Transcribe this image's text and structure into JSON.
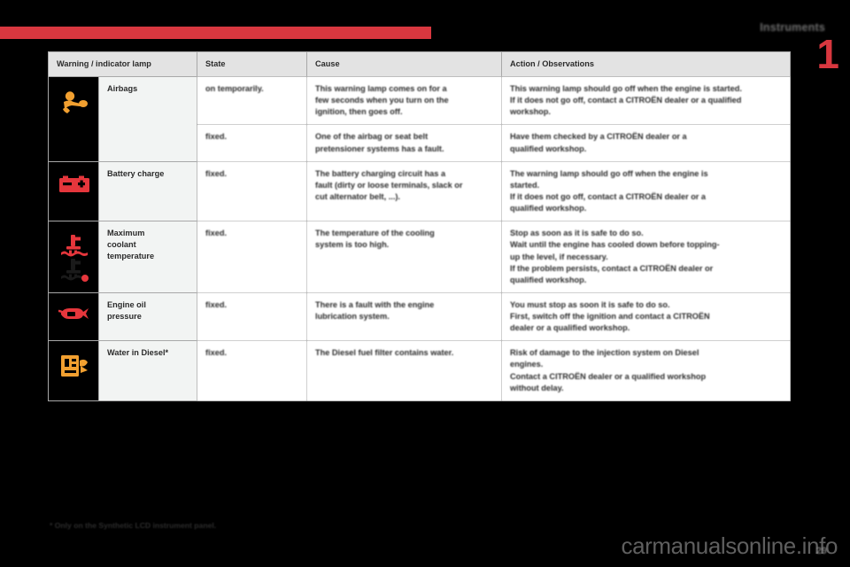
{
  "header": {
    "chapter_title": "Instruments",
    "chapter_number": "1",
    "rule_color": "#d8373f"
  },
  "table": {
    "columns": [
      {
        "label_main": "Warning",
        "separator": " / ",
        "label_sub": "indicator lamp",
        "full": "Warning / indicator lamp"
      },
      {
        "full": "State"
      },
      {
        "full": "Cause"
      },
      {
        "label_main": "Action",
        "separator": " / ",
        "label_sub": "Observations",
        "full": "Action / Observations"
      }
    ],
    "rows": [
      {
        "icon": "airbag-warning-icon",
        "icon_color": "#f2a030",
        "name": "Airbags",
        "name_rowspan": 2,
        "states": [
          {
            "state": "on temporarily.",
            "cause": [
              "This warning lamp comes on for a",
              "few seconds when you turn on the",
              "ignition, then goes off."
            ],
            "action": [
              "This warning lamp should go off when the engine is started.",
              "If it does not go off, contact a CITROËN dealer or a qualified",
              "workshop."
            ]
          },
          {
            "state": "fixed.",
            "cause": [
              "One of the airbag or seat belt",
              "pretensioner systems has a fault."
            ],
            "action": [
              "Have them checked by a CITROËN dealer or a",
              "qualified workshop."
            ]
          }
        ]
      },
      {
        "icon": "battery-charge-icon",
        "icon_color": "#e5363c",
        "name": "Battery charge",
        "name_rowspan": 1,
        "states": [
          {
            "state": "fixed.",
            "cause": [
              "The battery charging circuit has a",
              "fault (dirty or loose terminals, slack or",
              "cut alternator belt, ...)."
            ],
            "action": [
              "The warning lamp should go off when the engine is",
              "started.",
              "If it does not go off, contact a CITROËN dealer or a",
              "qualified workshop."
            ]
          }
        ]
      },
      {
        "icon": "coolant-temperature-icon",
        "icon_color": "#e5363c",
        "name": "Maximum coolant temperature",
        "name_lines": [
          "Maximum",
          "coolant",
          "temperature"
        ],
        "name_rowspan": 1,
        "states": [
          {
            "state": "fixed.",
            "cause": [
              "The temperature of the cooling",
              "system is too high."
            ],
            "action": [
              "Stop as soon as it is safe to do so.",
              "Wait until the engine has cooled down before topping-",
              "up the level, if necessary.",
              "If the problem persists, contact a CITROËN dealer or",
              "qualified workshop."
            ]
          }
        ]
      },
      {
        "icon": "engine-oil-pressure-icon",
        "icon_color": "#e5363c",
        "name": "Engine oil pressure",
        "name_lines": [
          "Engine oil",
          "pressure"
        ],
        "name_rowspan": 1,
        "states": [
          {
            "state": "fixed.",
            "cause": [
              "There is a fault with the engine",
              "lubrication system."
            ],
            "action": [
              "You must stop as soon it is safe to do so.",
              "First, switch off the ignition and contact a CITROËN",
              "dealer or a qualified workshop."
            ]
          }
        ]
      },
      {
        "icon": "water-in-diesel-icon",
        "icon_color": "#f2a030",
        "name": "Water in Diesel*",
        "name_rowspan": 1,
        "states": [
          {
            "state": "fixed.",
            "cause": [
              "The Diesel fuel filter contains water."
            ],
            "action": [
              "Risk of damage to the injection system on Diesel",
              "engines.",
              "Contact a CITROËN dealer or a qualified workshop",
              "without delay."
            ]
          }
        ]
      }
    ]
  },
  "footnote": "* Only on the Synthetic LCD instrument panel.",
  "page_number": "29",
  "watermark": "carmanualsonline.info"
}
